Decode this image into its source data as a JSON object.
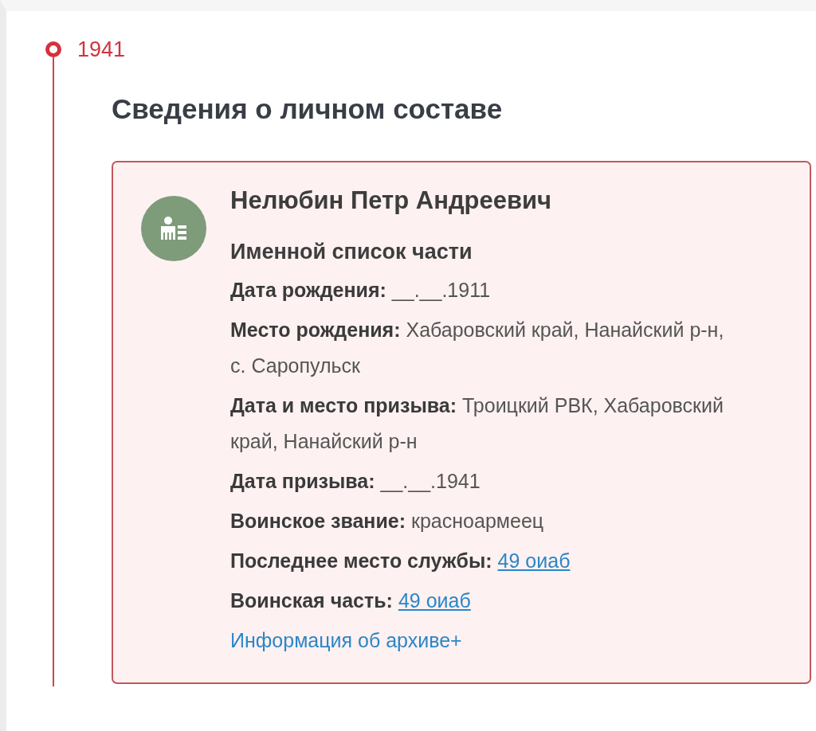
{
  "timeline": {
    "year": "1941"
  },
  "section": {
    "title": "Сведения о личном составе"
  },
  "card": {
    "name": "Нелюбин Петр Андреевич",
    "document_type": "Именной список части",
    "fields": [
      {
        "kind": "text",
        "label": "Дата рождения:",
        "value": "__.__.1911"
      },
      {
        "kind": "text",
        "label": "Место рождения:",
        "value": "Хабаровский край, Нанайский р-н, с. Саропульск"
      },
      {
        "kind": "text",
        "label": "Дата и место призыва:",
        "value": "Троицкий РВК, Хабаровский край, Нанайский р-н"
      },
      {
        "kind": "text",
        "label": "Дата призыва:",
        "value": "__.__.1941"
      },
      {
        "kind": "text",
        "label": "Воинское звание:",
        "value": "красноармеец"
      },
      {
        "kind": "link",
        "label": "Последнее место службы:",
        "value": "49 оиаб"
      },
      {
        "kind": "link",
        "label": "Воинская часть:",
        "value": "49 оиаб"
      }
    ],
    "archive_link": "Информация об архиве+"
  }
}
